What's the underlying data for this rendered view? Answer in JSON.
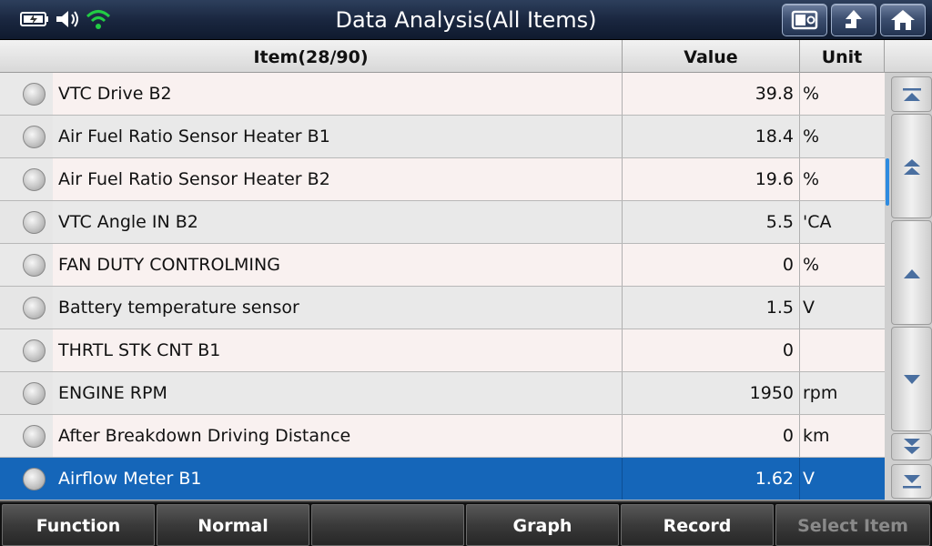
{
  "title": "Data Analysis(All Items)",
  "status_icons": [
    "battery-icon",
    "speaker-icon",
    "wifi-icon"
  ],
  "header_buttons": [
    "screenshot-icon",
    "back-icon",
    "home-icon"
  ],
  "columns": {
    "item": "Item(28/90)",
    "value": "Value",
    "unit": "Unit"
  },
  "rows": [
    {
      "name": "VTC Drive B2",
      "value": "39.8",
      "unit": "%"
    },
    {
      "name": "Air Fuel Ratio Sensor Heater B1",
      "value": "18.4",
      "unit": "%"
    },
    {
      "name": "Air Fuel Ratio Sensor Heater B2",
      "value": "19.6",
      "unit": "%"
    },
    {
      "name": "VTC Angle IN B2",
      "value": "5.5",
      "unit": "'CA"
    },
    {
      "name": "FAN DUTY CONTROLMING",
      "value": "0",
      "unit": "%"
    },
    {
      "name": "Battery temperature sensor",
      "value": "1.5",
      "unit": "V"
    },
    {
      "name": "THRTL STK CNT B1",
      "value": "0",
      "unit": ""
    },
    {
      "name": "ENGINE RPM",
      "value": "1950",
      "unit": "rpm"
    },
    {
      "name": "After Breakdown Driving Distance",
      "value": "0",
      "unit": "km"
    },
    {
      "name": "Airflow Meter B1",
      "value": "1.62",
      "unit": "V"
    }
  ],
  "selected_row_index": 9,
  "scroll_buttons": [
    "scroll-top-icon",
    "page-up-icon",
    "line-up-icon",
    "line-down-icon",
    "page-down-icon",
    "scroll-bottom-icon"
  ],
  "toolbar": {
    "function": "Function",
    "normal": "Normal",
    "blank": "",
    "graph": "Graph",
    "record": "Record",
    "select_item": "Select Item"
  },
  "colors": {
    "selected": "#1566b9",
    "wifi": "#22cc44",
    "scroll_indicator": "#2e8be0"
  }
}
